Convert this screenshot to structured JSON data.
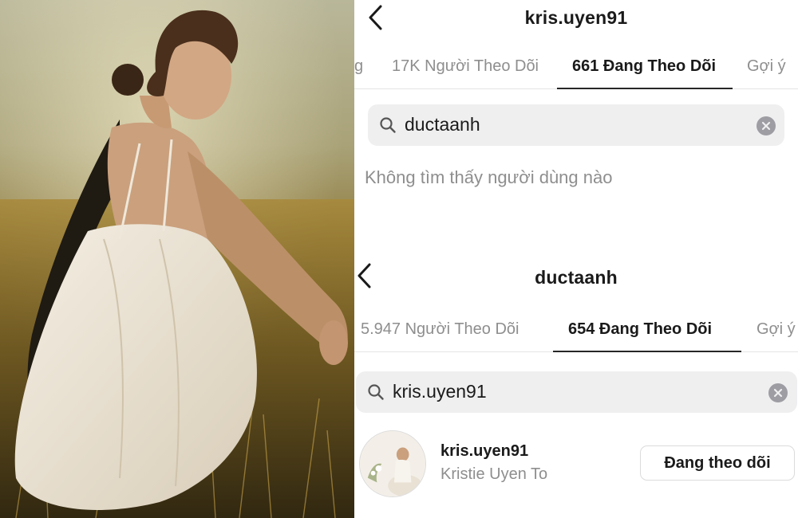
{
  "top_screen": {
    "title": "kris.uyen91",
    "tabs": [
      {
        "label": "g"
      },
      {
        "label": "17K Người Theo Dõi"
      },
      {
        "label": "661 Đang Theo Dõi",
        "active": true
      },
      {
        "label": "Gợi ý"
      }
    ],
    "search": {
      "query": "ductaanh"
    },
    "empty_message": "Không tìm thấy người dùng nào"
  },
  "bottom_screen": {
    "title": "ductaanh",
    "tabs": [
      {
        "label": "5.947 Người Theo Dõi"
      },
      {
        "label": "654 Đang Theo Dõi",
        "active": true
      },
      {
        "label": "Gợi ý"
      }
    ],
    "search": {
      "query": "kris.uyen91"
    },
    "result": {
      "username": "kris.uyen91",
      "full_name": "Kristie Uyen To",
      "button_label": "Đang theo dõi"
    }
  },
  "icons": [
    "back-arrow-icon",
    "search-icon",
    "clear-icon"
  ],
  "colors": {
    "text": "#262626",
    "muted": "#8e8e8e",
    "search_bg": "#efeff0",
    "divider": "#e4e4e4"
  }
}
